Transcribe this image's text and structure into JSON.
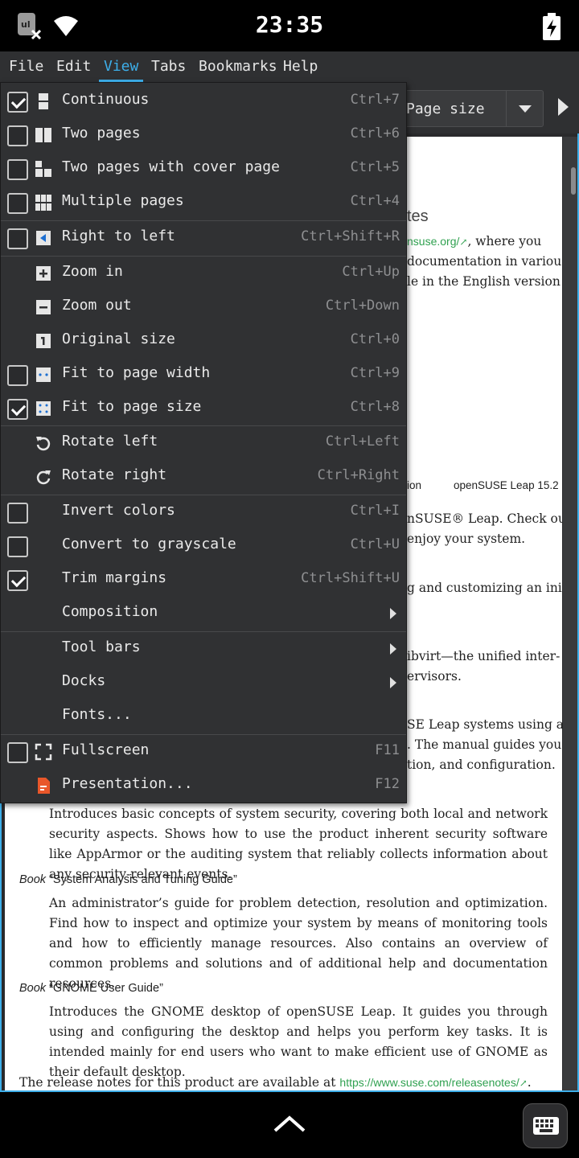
{
  "status_bar": {
    "time": "23:35",
    "icons": [
      "app-notification-icon",
      "wifi-icon",
      "battery-charging-icon"
    ]
  },
  "menubar": {
    "items": [
      {
        "label": "File",
        "active": false
      },
      {
        "label": "Edit",
        "active": false
      },
      {
        "label": "View",
        "active": true
      },
      {
        "label": "Tabs",
        "active": false
      },
      {
        "label": "Bookmarks",
        "active": false
      },
      {
        "label": "Help",
        "active": false
      }
    ]
  },
  "toolbar": {
    "page_size_combo": "Page size"
  },
  "view_menu": {
    "items": [
      {
        "label": "Continuous",
        "shortcut": "Ctrl+7",
        "checkbox": true,
        "checked": true,
        "icon": "continuous-icon"
      },
      {
        "label": "Two pages",
        "shortcut": "Ctrl+6",
        "checkbox": true,
        "checked": false,
        "icon": "two-pages-icon"
      },
      {
        "label": "Two pages with cover page",
        "shortcut": "Ctrl+5",
        "checkbox": true,
        "checked": false,
        "icon": "cover-page-icon"
      },
      {
        "label": "Multiple pages",
        "shortcut": "Ctrl+4",
        "checkbox": true,
        "checked": false,
        "icon": "multiple-pages-icon"
      },
      {
        "label": "Right to left",
        "shortcut": "Ctrl+Shift+R",
        "checkbox": true,
        "checked": false,
        "icon": "right-to-left-icon"
      },
      {
        "label": "Zoom in",
        "shortcut": "Ctrl+Up",
        "checkbox": false,
        "icon": "zoom-in-icon"
      },
      {
        "label": "Zoom out",
        "shortcut": "Ctrl+Down",
        "checkbox": false,
        "icon": "zoom-out-icon"
      },
      {
        "label": "Original size",
        "shortcut": "Ctrl+0",
        "checkbox": false,
        "icon": "original-size-icon"
      },
      {
        "label": "Fit to page width",
        "shortcut": "Ctrl+9",
        "checkbox": true,
        "checked": false,
        "icon": "fit-width-icon"
      },
      {
        "label": "Fit to page size",
        "shortcut": "Ctrl+8",
        "checkbox": true,
        "checked": true,
        "icon": "fit-size-icon"
      },
      {
        "label": "Rotate left",
        "shortcut": "Ctrl+Left",
        "checkbox": false,
        "icon": "rotate-left-icon"
      },
      {
        "label": "Rotate right",
        "shortcut": "Ctrl+Right",
        "checkbox": false,
        "icon": "rotate-right-icon"
      },
      {
        "label": "Invert colors",
        "shortcut": "Ctrl+I",
        "checkbox": true,
        "checked": false
      },
      {
        "label": "Convert to grayscale",
        "shortcut": "Ctrl+U",
        "checkbox": true,
        "checked": false
      },
      {
        "label": "Trim margins",
        "shortcut": "Ctrl+Shift+U",
        "checkbox": true,
        "checked": true
      },
      {
        "label": "Composition",
        "submenu": true
      },
      {
        "label": "Tool bars",
        "submenu": true
      },
      {
        "label": "Docks",
        "submenu": true
      },
      {
        "label": "Fonts..."
      },
      {
        "label": "Fullscreen",
        "shortcut": "F11",
        "checkbox": true,
        "checked": false,
        "icon": "fullscreen-icon"
      },
      {
        "label": "Presentation...",
        "shortcut": "F12",
        "checkbox": false,
        "icon": "presentation-icon"
      }
    ]
  },
  "document": {
    "heading_fragment": "tes",
    "frag_lines": [
      {
        "pre": "",
        "link": "nsuse.org/",
        "post": ", where you"
      },
      {
        "pre": "documentation in various",
        "link": "",
        "post": ""
      },
      {
        "pre": "le in the English version",
        "link": "",
        "post": ""
      }
    ],
    "footer_left": "ion",
    "footer_right": "openSUSE Leap 15.2",
    "frag2": [
      "nSUSE® Leap. Check out",
      "enjoy your system.",
      "g and customizing an ini-",
      "ibvirt—the unified inter-",
      "ervisors.",
      "SE Leap systems using an",
      ". The manual guides you",
      "tion, and configuration."
    ],
    "security_para": "Introduces basic concepts of system security, covering both local and network security aspects. Shows how to use the product inherent security software like AppArmor or the auditing system that reliably collects information about any security-relevant events.",
    "books": [
      {
        "prefix": "Book",
        "title": "“System Analysis and Tuning Guide”",
        "text": "An administrator’s guide for problem detection, resolution and optimization. Find how to inspect and optimize your system by means of monitoring tools and how to efficiently manage resources. Also contains an overview of common problems and solutions and of additional help and documentation resources."
      },
      {
        "prefix": "Book",
        "title": "“GNOME User Guide”",
        "text": "Introduces the GNOME desktop of openSUSE Leap. It guides you through using and configuring the desktop and helps you perform key tasks. It is intended mainly for end users who want to make efficient use of GNOME as their default desktop."
      }
    ],
    "release_prefix": "The release notes for this product are available at ",
    "release_link": "https://www.suse.com/releasenotes/",
    "release_suffix": "."
  },
  "colors": {
    "accent": "#3daee9",
    "menu_bg": "#303133",
    "link": "#30a150",
    "presentation_icon": "#e9572a"
  }
}
